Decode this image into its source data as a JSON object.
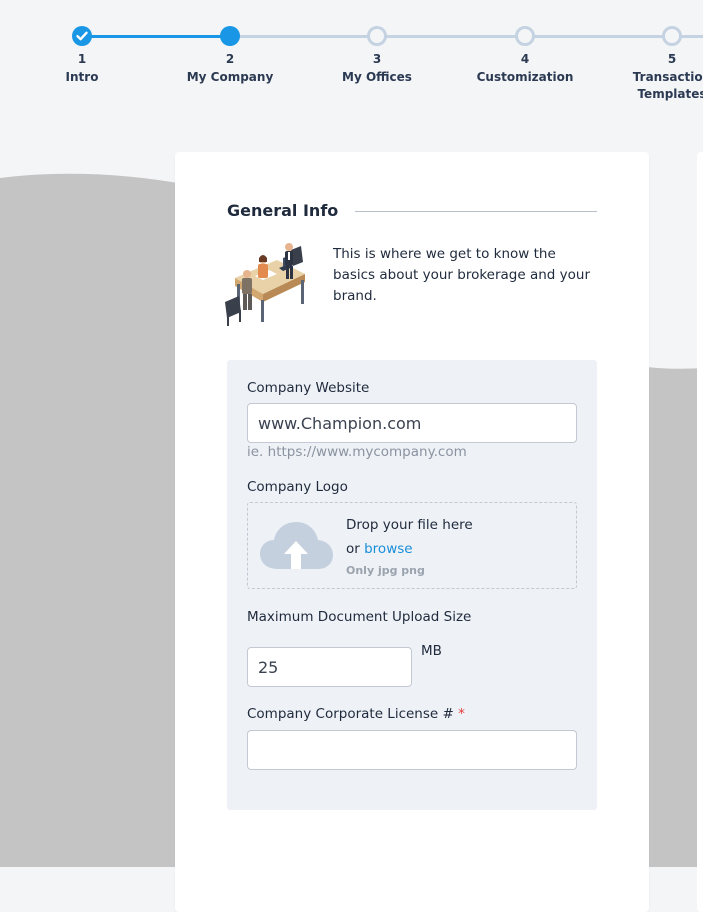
{
  "stepper": {
    "colors": {
      "done": "#1a96e6",
      "todo": "#c4d2e1"
    },
    "steps": [
      {
        "number": "1",
        "label": "Intro",
        "state": "complete"
      },
      {
        "number": "2",
        "label": "My Company",
        "state": "active"
      },
      {
        "number": "3",
        "label": "My Offices",
        "state": "todo"
      },
      {
        "number": "4",
        "label": "Customization",
        "state": "todo"
      },
      {
        "number": "5",
        "label": "Transaction",
        "label2": "Templates",
        "state": "todo"
      }
    ]
  },
  "section": {
    "title": "General Info",
    "intro_icon": "office-meeting-illustration",
    "intro": "This is where we get to know the basics about your brokerage and your brand."
  },
  "form": {
    "website": {
      "label": "Company Website",
      "value": "www.Champion.com",
      "hint": "ie. https://www.mycompany.com"
    },
    "logo": {
      "label": "Company Logo",
      "drop_text": "Drop your file here",
      "or_text": "or",
      "browse_text": "browse",
      "types_text": "Only jpg png",
      "icon": "cloud-upload-icon"
    },
    "max_upload": {
      "label": "Maximum Document Upload Size",
      "value": "25",
      "unit": "MB"
    },
    "license": {
      "label": "Company Corporate License #",
      "required_mark": "*",
      "value": ""
    }
  },
  "theme": {
    "accent": "#1a96e6",
    "link": "#1a8fd9",
    "required": "#e03a3a",
    "panel": "#eef1f6",
    "page_bg": "#f4f5f7",
    "wave": "#c4c4c4"
  }
}
